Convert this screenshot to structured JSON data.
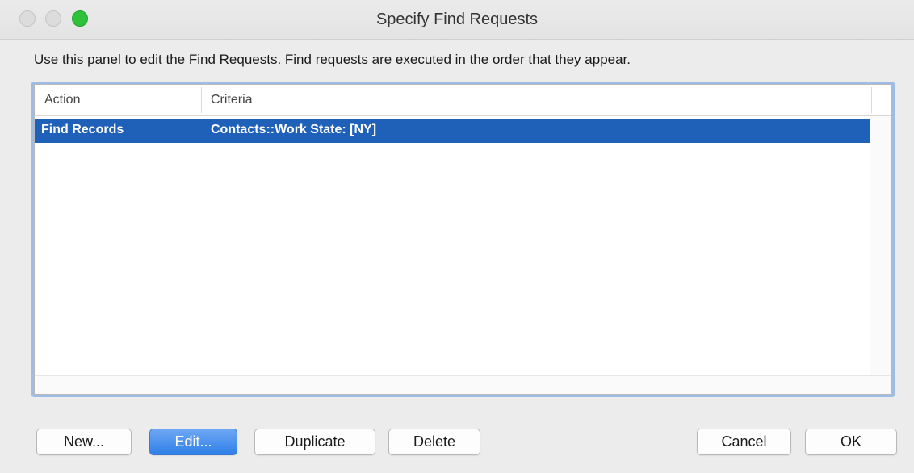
{
  "window": {
    "title": "Specify Find Requests"
  },
  "instructions": "Use this panel to edit the Find Requests. Find requests are executed in the order that they appear.",
  "table": {
    "columns": [
      "Action",
      "Criteria"
    ],
    "rows": [
      {
        "action": "Find Records",
        "criteria": "Contacts::Work State: [NY]",
        "selected": true
      }
    ]
  },
  "buttons": {
    "new": "New...",
    "edit": "Edit...",
    "duplicate": "Duplicate",
    "delete": "Delete",
    "cancel": "Cancel",
    "ok": "OK"
  },
  "colors": {
    "selection": "#1f60b8",
    "focus_ring": "#9dbde6",
    "default_button": "#2f7fe8",
    "zoom_button": "#2fc13a"
  }
}
